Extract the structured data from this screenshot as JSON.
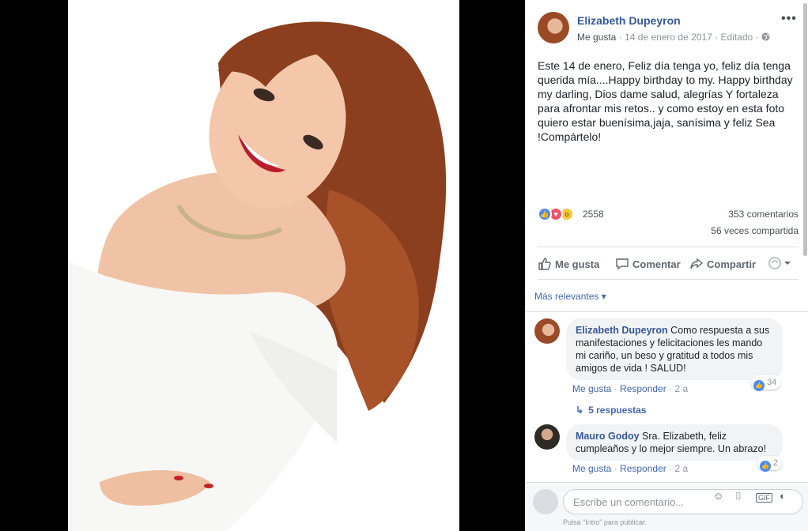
{
  "post": {
    "author": "Elizabeth Dupeyron",
    "meta_like": "Me gusta",
    "date": "14 de enero de 2017",
    "edited": "Editado",
    "text": "Este 14 de enero, Feliz día tenga yo, feliz día tenga querida mía....Happy birthday to my. Happy birthday my darling, Dios dame salud, alegrías Y fortaleza para afrontar mis retos.. y como estoy en esta foto quiero estar buenísima,jaja, sanísima y feliz Sea !Compártelo!",
    "more_icon": "•••"
  },
  "stats": {
    "reactions_count": "2558",
    "comments": "353 comentarios",
    "shares": "56 veces compartida"
  },
  "actions": {
    "like": "Me gusta",
    "comment": "Comentar",
    "share": "Compartir"
  },
  "sort": {
    "label": "Más relevantes ▾"
  },
  "comments": [
    {
      "author": "Elizabeth Dupeyron",
      "text": "Como respuesta a sus manifestaciones y felicitaciones les mando mi cariño, un beso y gratitud a todos mis amigos de vida ! SALUD!",
      "like": "Me gusta",
      "reply": "Responder",
      "time": "2 a",
      "reactions": "34"
    },
    {
      "author": "Mauro Godoy",
      "text": "Sra. Elizabeth, feliz cumpleaños y lo mejor siempre. Un abrazo!",
      "like": "Me gusta",
      "reply": "Responder",
      "time": "2 a",
      "reactions": "2"
    }
  ],
  "replies": {
    "arrow": "↳",
    "label": "5 respuestas"
  },
  "composer": {
    "placeholder": "Escribe un comentario...",
    "hint": "Pulsa \"Intro\" para publicar."
  },
  "colors": {
    "link": "#365899",
    "accent": "#4267b2"
  }
}
